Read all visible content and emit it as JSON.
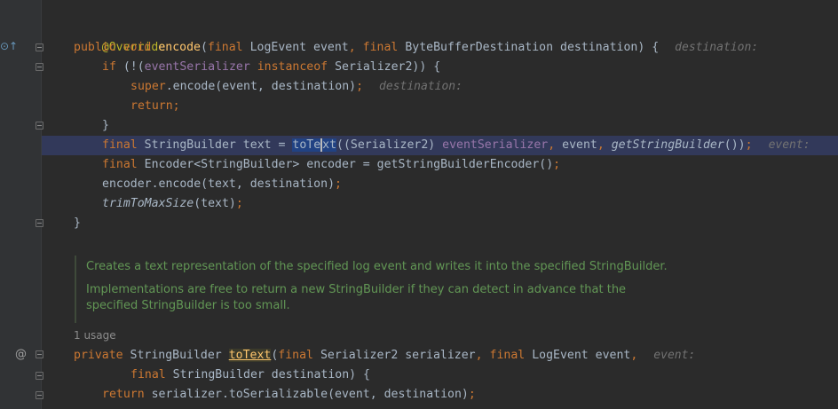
{
  "gutter": {
    "override_marker": "⊙↑",
    "at_marker": "@"
  },
  "code": {
    "l1": {
      "annotation": "@Override"
    },
    "l2": {
      "public": "public",
      "void": "void",
      "name": "encode",
      "open": "(",
      "final1": "final",
      "type1": "LogEvent",
      "param1": "event",
      "comma1": ",",
      "final2": "final",
      "type2": "ByteBufferDestination",
      "param2": "destination",
      "close": ") {",
      "hint": "destination:"
    },
    "l3": {
      "if": "if",
      "open": "(!(",
      "field": "eventSerializer",
      "instanceof": "instanceof",
      "rest": "Serializer2)) {"
    },
    "l4": {
      "super": "super",
      "call": ".encode(event, destination)",
      "semi": ";",
      "hint": "destination:"
    },
    "l5": {
      "return": "return",
      "semi": ";"
    },
    "l6": {
      "brace": "}"
    },
    "l7": {
      "final": "final",
      "decl": "StringBuilder text = ",
      "method_a": "toTe",
      "method_b": "xt",
      "cast": "((Serializer2) ",
      "field": "eventSerializer",
      "comma1": ",",
      "arg": " event",
      "comma2": ",",
      "call": "getStringBuilder",
      "end": "())",
      "semi": ";",
      "hint": "event:"
    },
    "l8": {
      "final": "final",
      "rest": "Encoder<StringBuilder> encoder = getStringBuilderEncoder()",
      "semi": ";"
    },
    "l9": {
      "rest": "encoder.encode(text, destination)",
      "semi": ";"
    },
    "l10": {
      "call": "trimToMaxSize",
      "rest": "(text)",
      "semi": ";"
    },
    "l11": {
      "brace": "}"
    },
    "l16": {
      "private": "private",
      "type": "StringBuilder",
      "name": "toText",
      "open": "(",
      "final1": "final",
      "type1": "Serializer2 serializer",
      "comma1": ",",
      "final2": "final",
      "type2": "LogEvent event",
      "comma2": ",",
      "hint": "event:"
    },
    "l17": {
      "final": "final",
      "rest": "StringBuilder destination) {"
    },
    "l18": {
      "return": "return",
      "rest": "serializer.toSerializable(event, destination)",
      "semi": ";"
    }
  },
  "doc": {
    "para1": "Creates a text representation of the specified log event and writes it into the specified StringBuilder.",
    "para2_line1": "Implementations are free to return a new StringBuilder if they can detect in advance that the",
    "para2_line2": "specified StringBuilder is too small."
  },
  "usage_hint": "1 usage"
}
